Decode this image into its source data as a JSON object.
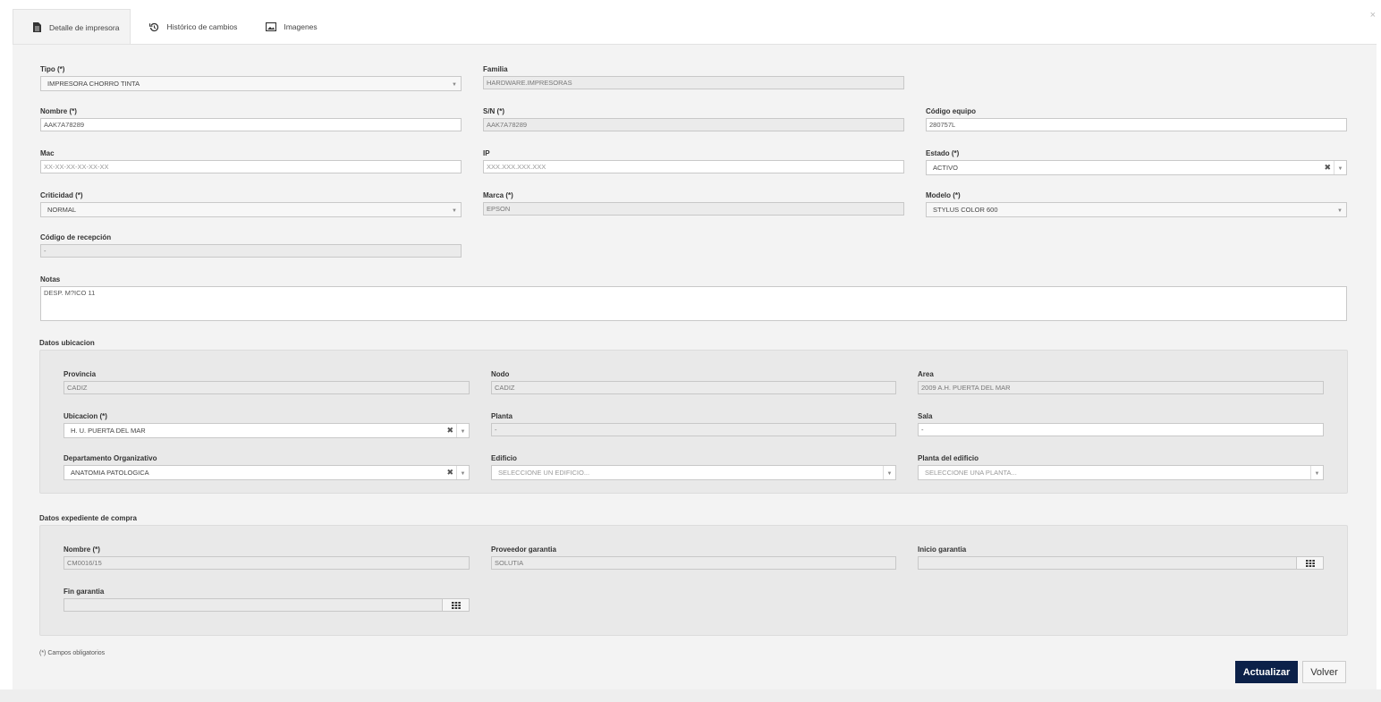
{
  "tabs": [
    {
      "label": "Detalle de impresora",
      "icon": "document-icon",
      "active": true
    },
    {
      "label": "Histórico de cambios",
      "icon": "history-icon",
      "active": false
    },
    {
      "label": "Imagenes",
      "icon": "image-icon",
      "active": false
    }
  ],
  "close_glyph": "×",
  "fields": {
    "tipo": {
      "label": "Tipo (*)",
      "value": "IMPRESORA CHORRO TINTA"
    },
    "familia": {
      "label": "Familia",
      "value": "HARDWARE.IMPRESORAS"
    },
    "nombre": {
      "label": "Nombre (*)",
      "value": "AAK7A78289"
    },
    "sn": {
      "label": "S/N (*)",
      "value": "AAK7A78289"
    },
    "codigo_equipo": {
      "label": "Código equipo",
      "value": "280757L"
    },
    "mac": {
      "label": "Mac",
      "placeholder": "XX-XX-XX-XX-XX-XX"
    },
    "ip": {
      "label": "IP",
      "placeholder": "XXX.XXX.XXX.XXX"
    },
    "estado": {
      "label": "Estado (*)",
      "value": "ACTIVO"
    },
    "criticidad": {
      "label": "Criticidad (*)",
      "value": "NORMAL"
    },
    "marca": {
      "label": "Marca (*)",
      "value": "EPSON"
    },
    "modelo": {
      "label": "Modelo (*)",
      "value": "STYLUS COLOR 600"
    },
    "codigo_recepcion": {
      "label": "Código de recepción",
      "value": "-"
    },
    "notas": {
      "label": "Notas",
      "value": "DESP. M?ICO 11"
    }
  },
  "ubicacion": {
    "title": "Datos ubicacion",
    "provincia": {
      "label": "Provincia",
      "value": "CADIZ"
    },
    "nodo": {
      "label": "Nodo",
      "value": "CADIZ"
    },
    "area": {
      "label": "Area",
      "value": "2009 A.H. PUERTA DEL MAR"
    },
    "ubicacion": {
      "label": "Ubicacion (*)",
      "value": "H. U. PUERTA DEL MAR"
    },
    "planta": {
      "label": "Planta",
      "value": "-"
    },
    "sala": {
      "label": "Sala",
      "value": "-"
    },
    "departamento": {
      "label": "Departamento Organizativo",
      "value": "ANATOMIA PATOLOGICA"
    },
    "edificio": {
      "label": "Edificio",
      "placeholder": "SELECCIONE UN EDIFICIO..."
    },
    "planta_edificio": {
      "label": "Planta del edificio",
      "placeholder": "SELECCIONE UNA PLANTA..."
    }
  },
  "compra": {
    "title": "Datos expediente de compra",
    "nombre": {
      "label": "Nombre (*)",
      "value": "CM0016/15"
    },
    "proveedor": {
      "label": "Proveedor garantia",
      "value": "SOLUTIA"
    },
    "inicio": {
      "label": "Inicio garantia",
      "value": ""
    },
    "fin": {
      "label": "Fin garantia",
      "value": ""
    }
  },
  "footer": {
    "note": "(*) Campos obligatorios",
    "update_label": "Actualizar",
    "back_label": "Volver"
  },
  "colors": {
    "primary_button": "#0c2149",
    "panel_bg": "#f3f3f3"
  }
}
